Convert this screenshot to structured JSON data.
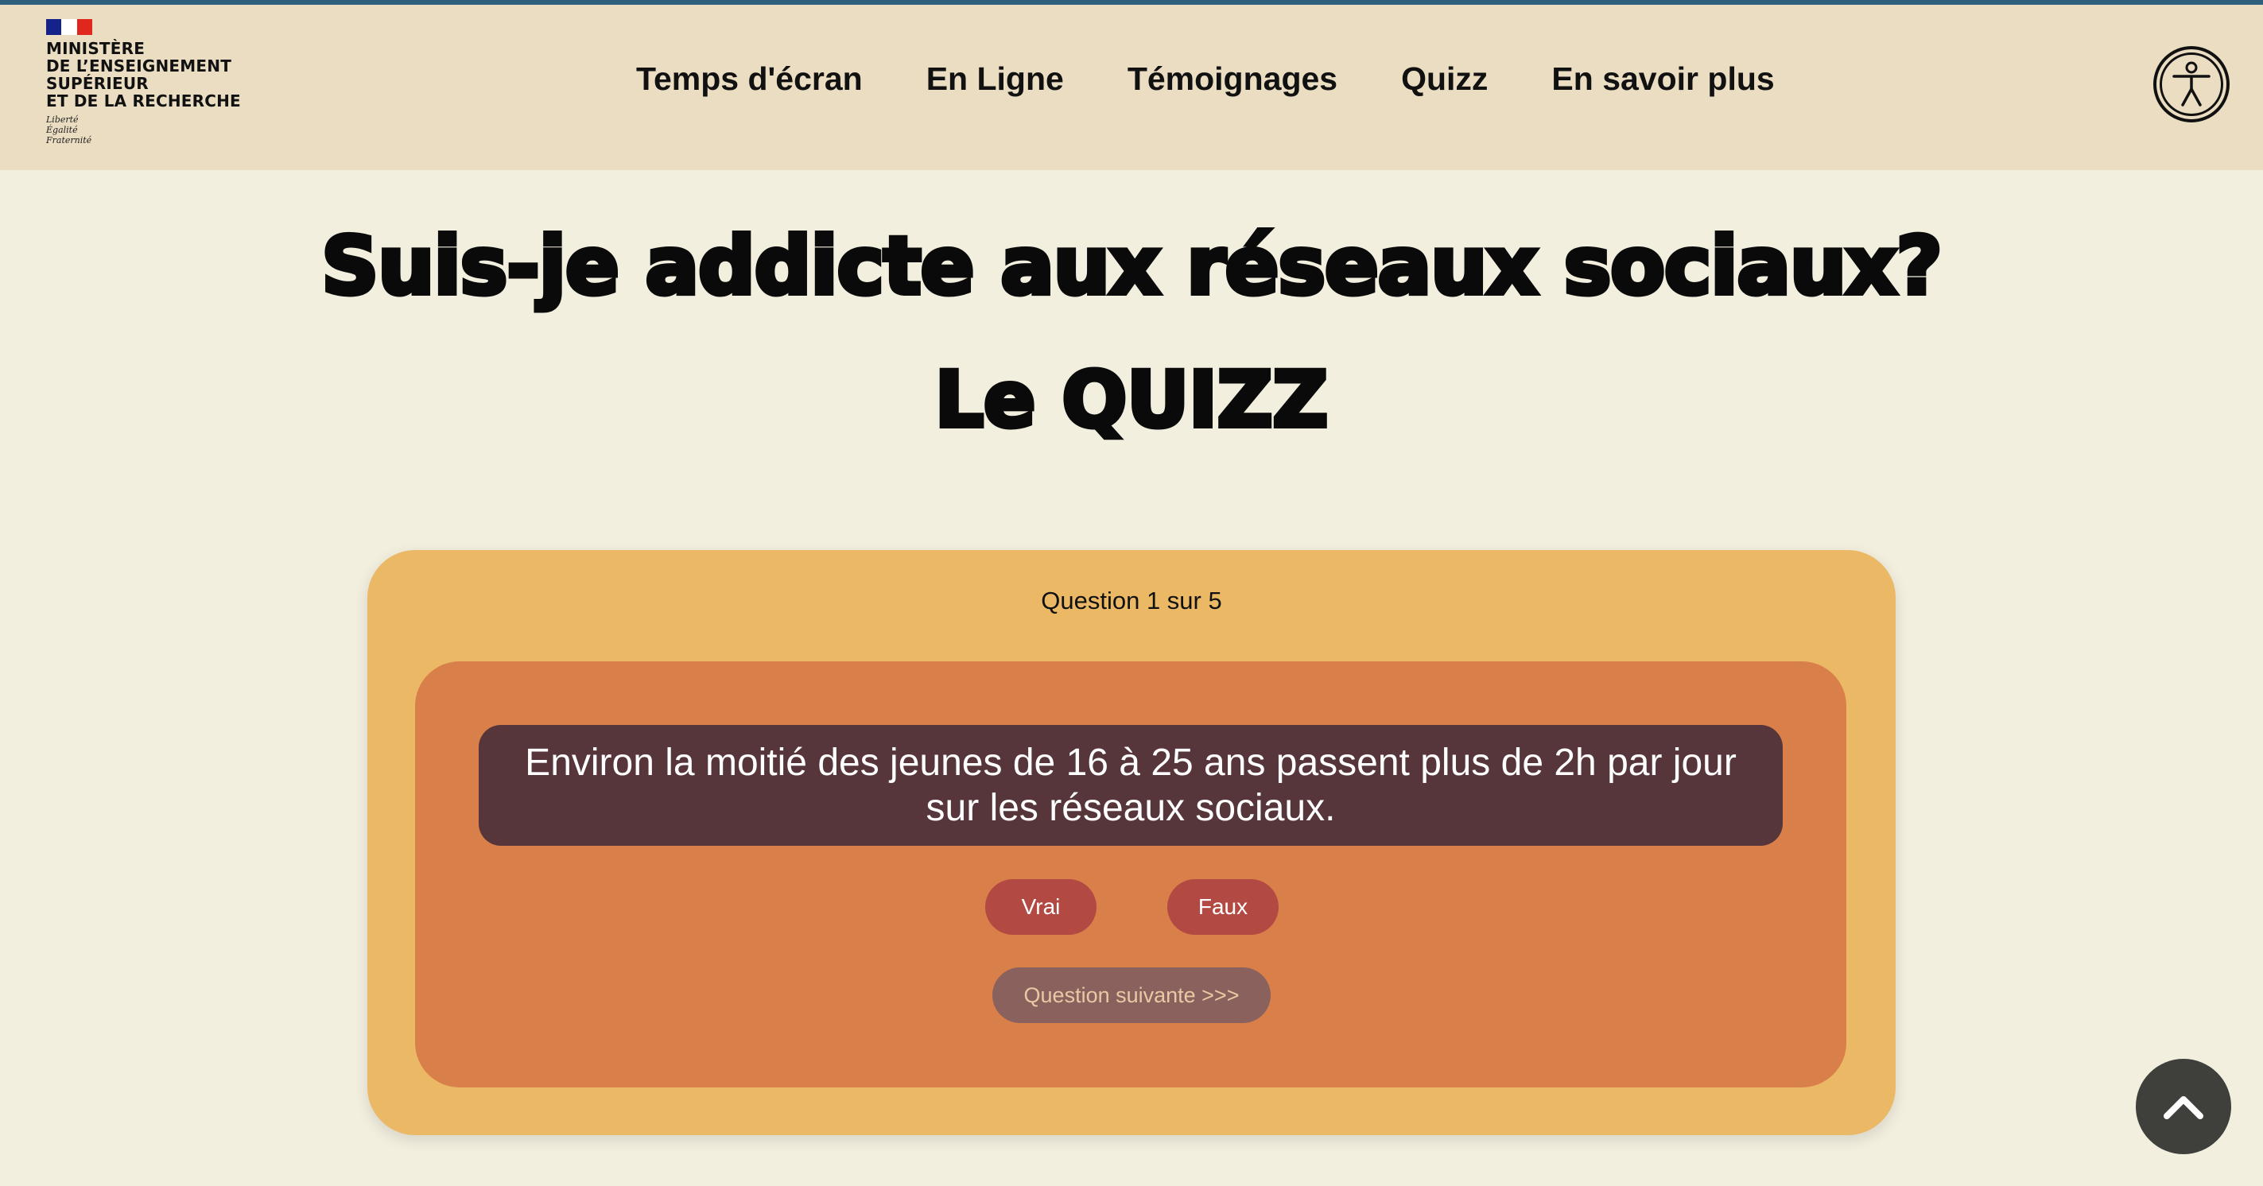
{
  "header": {
    "logo": {
      "lines": [
        "MINISTÈRE",
        "DE L’ENSEIGNEMENT",
        "SUPÉRIEUR",
        "ET DE LA RECHERCHE"
      ],
      "motto": [
        "Liberté",
        "Égalité",
        "Fraternité"
      ]
    },
    "nav": [
      {
        "label": "Temps d'écran"
      },
      {
        "label": "En Ligne"
      },
      {
        "label": "Témoignages"
      },
      {
        "label": "Quizz"
      },
      {
        "label": "En savoir plus"
      }
    ],
    "accessibility_icon": "accessibility-person-icon"
  },
  "main": {
    "title": "Suis-je addicte aux réseaux sociaux?",
    "subtitle": "Le QUIZZ"
  },
  "quiz": {
    "progress": "Question 1 sur 5",
    "question": "Environ la moitié des jeunes de 16 à 25 ans passent plus de 2h par jour sur les réseaux sociaux.",
    "answers": {
      "true_label": "Vrai",
      "false_label": "Faux"
    },
    "next_label": "Question suivante >>>"
  },
  "scroll_top_icon": "chevron-up-icon",
  "colors": {
    "page_bg": "#f3efdf",
    "header_bg": "#eaddc1",
    "top_accent": "#2f5f7e",
    "card_outer": "#ebb966",
    "card_inner": "#d87f4a",
    "question_bg": "#56353b",
    "answer_btn": "#b24a43",
    "next_btn": "#8b615d",
    "scroll_btn": "#3f3f3b"
  }
}
